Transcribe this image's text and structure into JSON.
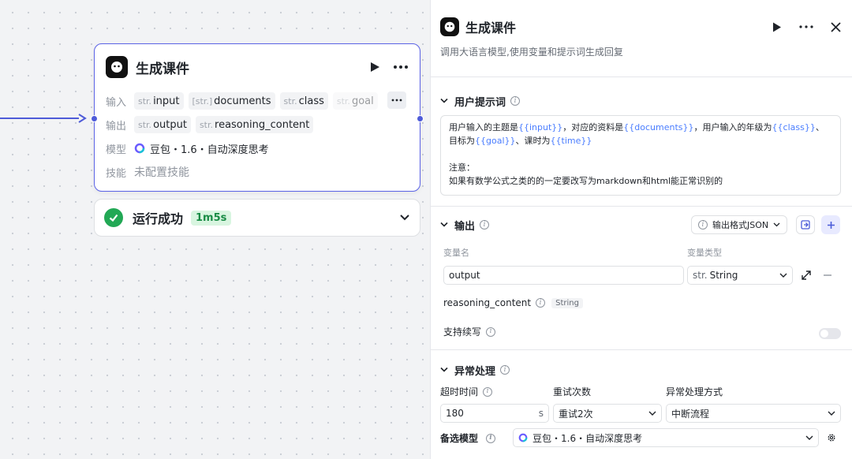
{
  "node": {
    "title": "生成课件",
    "inputs_label": "输入",
    "outputs_label": "输出",
    "model_label": "模型",
    "skills_label": "技能",
    "inputs": [
      {
        "type": "str.",
        "name": "input"
      },
      {
        "type": "[str.]",
        "name": "documents"
      },
      {
        "type": "str.",
        "name": "class"
      },
      {
        "type": "str.",
        "name": "goal"
      }
    ],
    "outputs": [
      {
        "type": "str.",
        "name": "output"
      },
      {
        "type": "str.",
        "name": "reasoning_content"
      }
    ],
    "model": "豆包・1.6・自动深度思考",
    "skills": "未配置技能"
  },
  "result": {
    "text": "运行成功",
    "duration": "1m5s"
  },
  "panel": {
    "title": "生成课件",
    "description": "调用大语言模型,使用变量和提示词生成回复",
    "user_prompt": {
      "title": "用户提示词",
      "t1": "用户输入的主题是",
      "v1": "{{input}}",
      "t2": "，对应的资料是",
      "v2": "{{documents}}",
      "t3": "，用户输入的年级为",
      "v3": "{{class}}",
      "t4": "、目标为",
      "v4": "{{goal}}",
      "t5": "、课时为",
      "v5": "{{time}}",
      "note_title": "注意：",
      "note_body": "如果有数学公式之类的的一定要改写为markdown和html能正常识别的"
    },
    "output": {
      "title": "输出",
      "format_button": "输出格式JSON",
      "col_name": "变量名",
      "col_type": "变量类型",
      "var_name": "output",
      "var_type_prefix": "str.",
      "var_type": "String",
      "second_var": "reasoning_content",
      "second_type": "String",
      "continue_label": "支持续写"
    },
    "error": {
      "title": "异常处理",
      "timeout_label": "超时时间",
      "retry_label": "重试次数",
      "method_label": "异常处理方式",
      "timeout_value": "180",
      "timeout_unit": "s",
      "retry_value": "重试2次",
      "method_value": "中断流程",
      "backup_label": "备选模型",
      "backup_model": "豆包・1.6・自动深度思考"
    }
  },
  "colors": {
    "accent": "#5b63e6",
    "success": "#22a855",
    "variable": "#4a7dff"
  }
}
